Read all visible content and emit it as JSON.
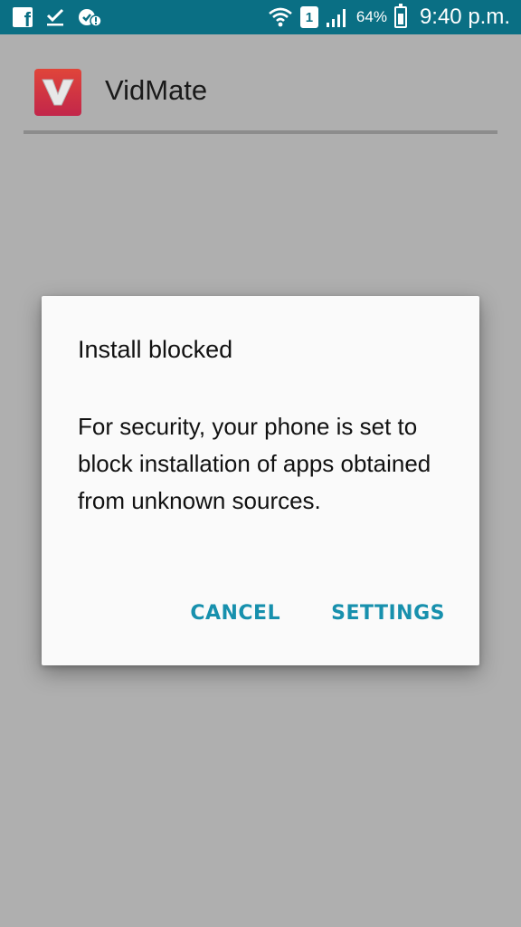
{
  "status_bar": {
    "icons_left": [
      "facebook-icon",
      "check-download-icon",
      "security-alert-icon"
    ],
    "icons_right": [
      "wifi-icon",
      "sim-icon",
      "signal-icon",
      "battery-icon"
    ],
    "sim_label": "1",
    "battery": "64%",
    "time": "9:40 p.m.",
    "bg_color": "#0a6f84"
  },
  "app": {
    "name": "VidMate",
    "logo_letter": "V"
  },
  "dialog": {
    "title": "Install blocked",
    "message": "For security, your phone is set to block installation of apps obtained from unknown sources.",
    "cancel_label": "CANCEL",
    "settings_label": "SETTINGS",
    "accent_color": "#1790ad"
  }
}
